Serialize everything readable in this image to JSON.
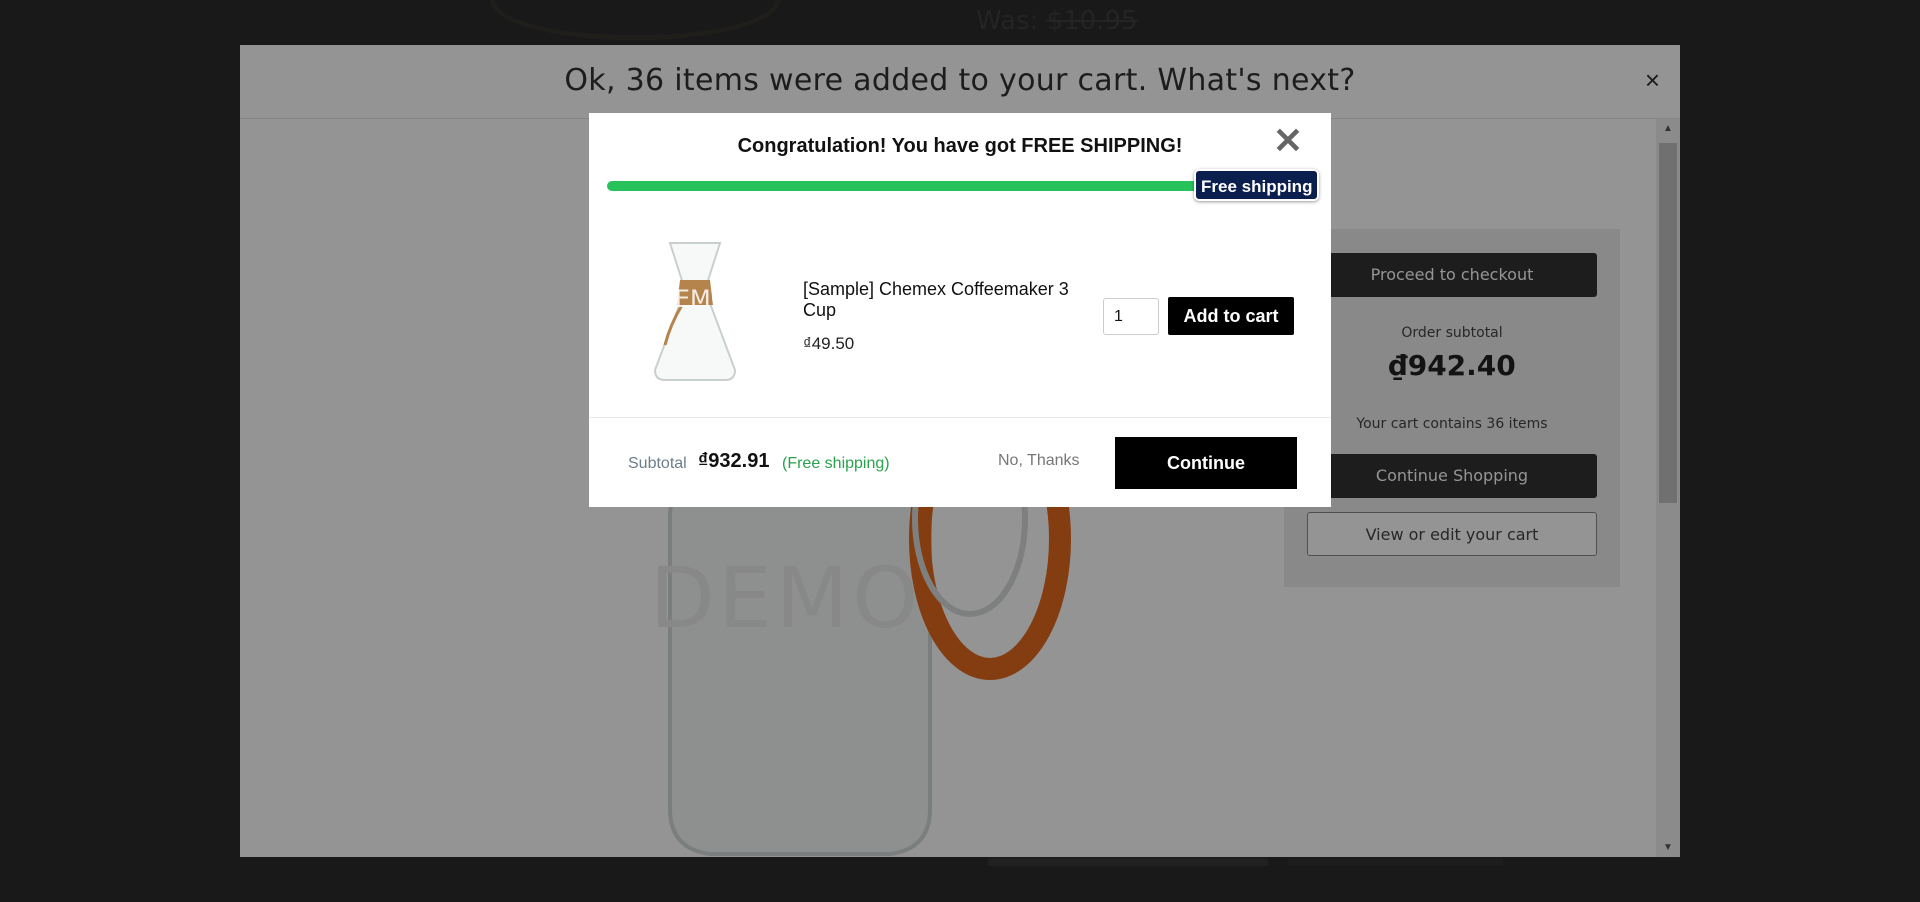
{
  "background": {
    "was_label": "Was:",
    "was_price": "$10.95"
  },
  "outer_modal": {
    "title": "Ok, 36 items were added to your cart. What's next?",
    "close_symbol": "×",
    "demo_watermark": "DEMO",
    "panel": {
      "checkout_label": "Proceed to checkout",
      "subtotal_label": "Order subtotal",
      "subtotal_value": "₫942.40",
      "count_text": "Your cart contains 36 items",
      "continue_label": "Continue Shopping",
      "view_edit_label": "View or edit your cart"
    },
    "scroll_up": "▲",
    "scroll_down": "▼"
  },
  "popup": {
    "title": "Congratulation! You have got FREE SHIPPING!",
    "close_symbol": "✕",
    "progress": 1.0,
    "progress_color": "#27c25c",
    "badge_label": "Free shipping",
    "badge_color": "#0b1f4e",
    "product": {
      "name": "[Sample] Chemex Coffeemaker 3 Cup",
      "price": "₫49.50",
      "quantity": "1",
      "demo_watermark": "DEMO",
      "add_label": "Add to cart"
    },
    "footer": {
      "subtotal_label": "Subtotal",
      "subtotal_value": "₫932.91",
      "free_label": "(Free shipping)",
      "no_thanks_label": "No, Thanks",
      "continue_label": "Continue"
    }
  }
}
